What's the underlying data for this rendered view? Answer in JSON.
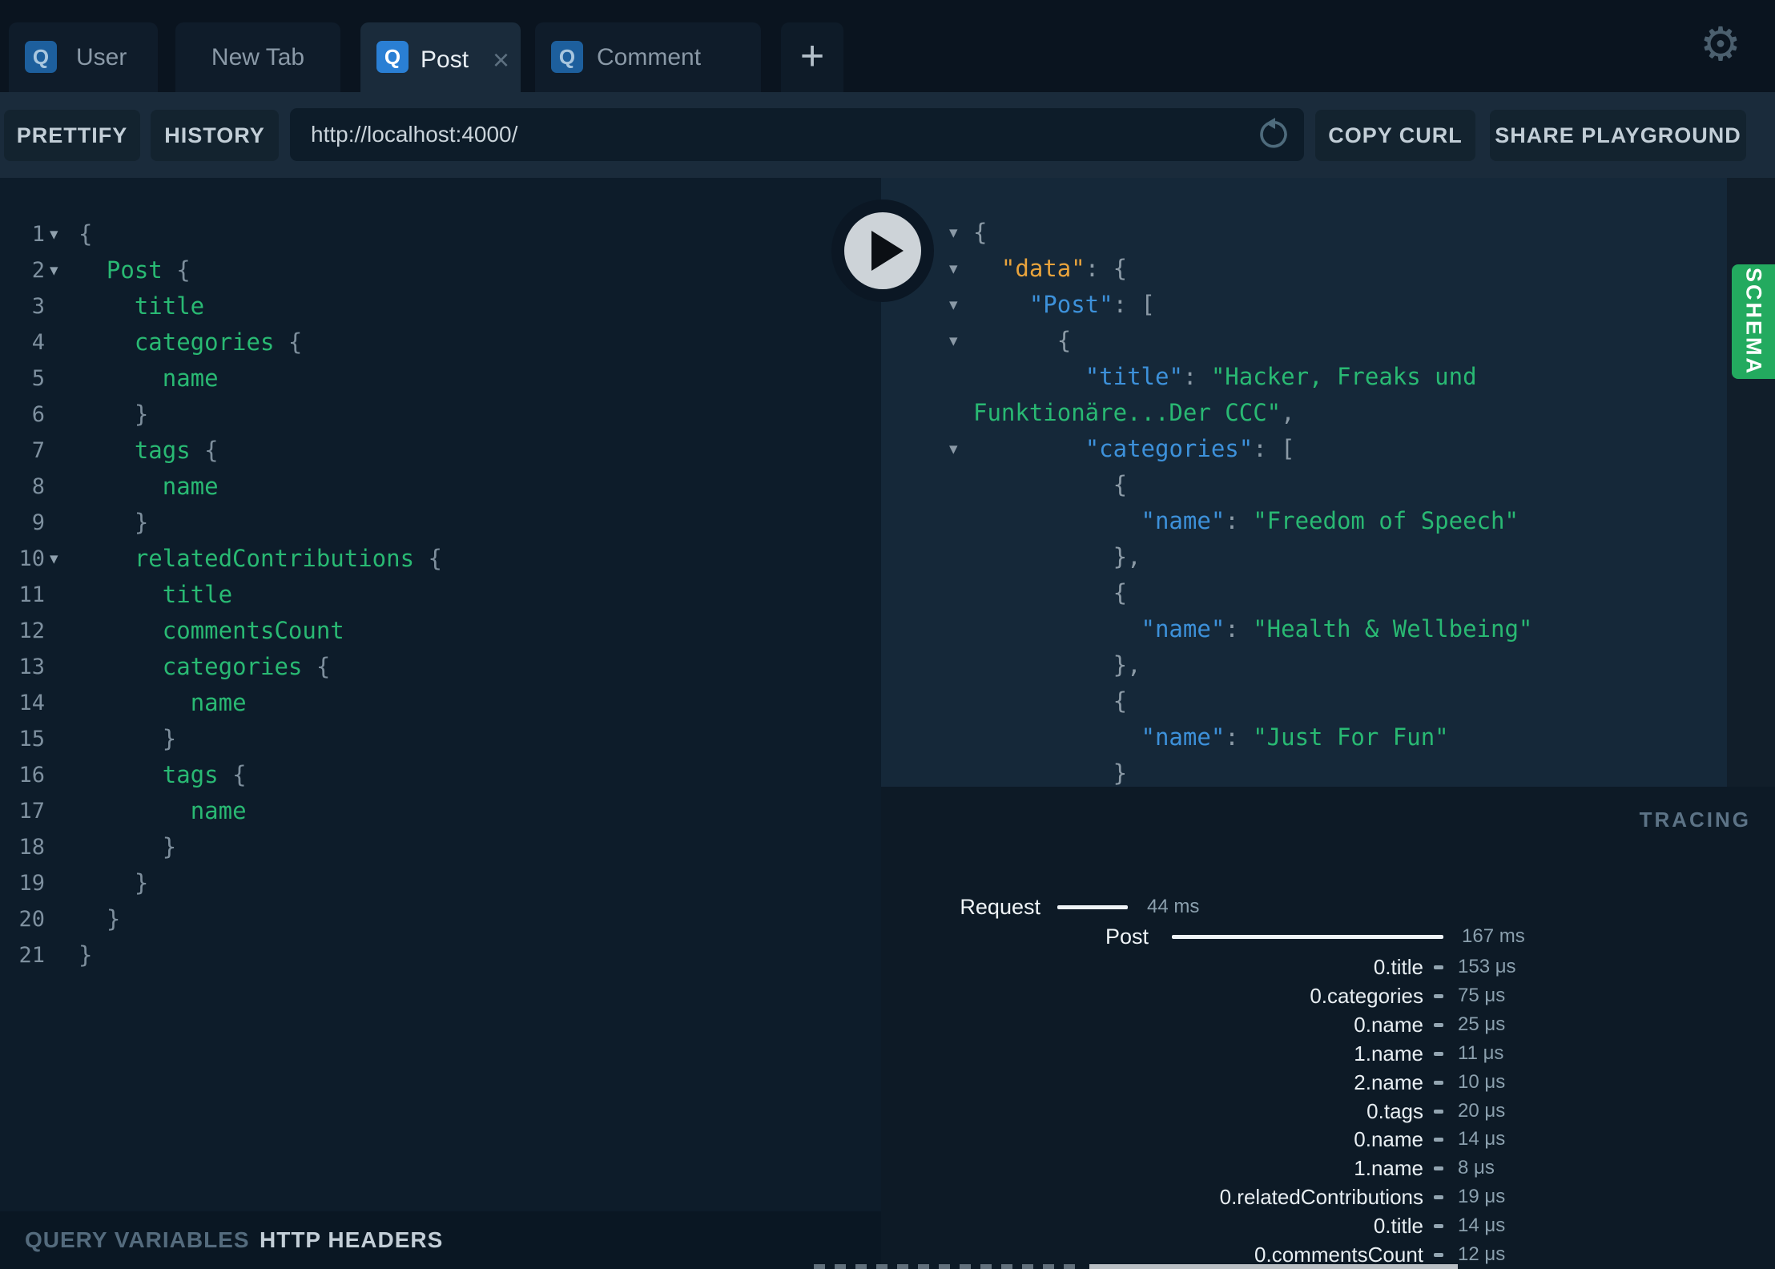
{
  "icons": {
    "gear": "⚙",
    "fold": "▾",
    "close": "×",
    "plus": "+",
    "badge_query": "Q"
  },
  "tabbar": {
    "tabs": [
      {
        "label": "User",
        "badge": "Q",
        "active": false,
        "closable": false
      },
      {
        "label": "New Tab",
        "badge": null,
        "active": false,
        "closable": false
      },
      {
        "label": "Post",
        "badge": "Q",
        "active": true,
        "closable": true
      },
      {
        "label": "Comment",
        "badge": "Q",
        "active": false,
        "closable": false
      }
    ]
  },
  "toolbar": {
    "prettify_label": "PRETTIFY",
    "history_label": "HISTORY",
    "url_value": "http://localhost:4000/",
    "copy_curl_label": "COPY CURL",
    "share_label": "SHARE PLAYGROUND"
  },
  "query_editor": {
    "lines": [
      {
        "n": 1,
        "ind": 0,
        "field": "",
        "brace": "{",
        "fold": true
      },
      {
        "n": 2,
        "ind": 2,
        "field": "Post",
        "brace": " {",
        "fold": true
      },
      {
        "n": 3,
        "ind": 4,
        "field": "title",
        "brace": "",
        "fold": false
      },
      {
        "n": 4,
        "ind": 4,
        "field": "categories",
        "brace": " {",
        "fold": false
      },
      {
        "n": 5,
        "ind": 6,
        "field": "name",
        "brace": "",
        "fold": false
      },
      {
        "n": 6,
        "ind": 4,
        "field": "",
        "brace": "}",
        "fold": false
      },
      {
        "n": 7,
        "ind": 4,
        "field": "tags",
        "brace": " {",
        "fold": false
      },
      {
        "n": 8,
        "ind": 6,
        "field": "name",
        "brace": "",
        "fold": false
      },
      {
        "n": 9,
        "ind": 4,
        "field": "",
        "brace": "}",
        "fold": false
      },
      {
        "n": 10,
        "ind": 4,
        "field": "relatedContributions",
        "brace": " {",
        "fold": true
      },
      {
        "n": 11,
        "ind": 6,
        "field": "title",
        "brace": "",
        "fold": false
      },
      {
        "n": 12,
        "ind": 6,
        "field": "commentsCount",
        "brace": "",
        "fold": false
      },
      {
        "n": 13,
        "ind": 6,
        "field": "categories",
        "brace": " {",
        "fold": false
      },
      {
        "n": 14,
        "ind": 8,
        "field": "name",
        "brace": "",
        "fold": false
      },
      {
        "n": 15,
        "ind": 6,
        "field": "",
        "brace": "}",
        "fold": false
      },
      {
        "n": 16,
        "ind": 6,
        "field": "tags",
        "brace": " {",
        "fold": false
      },
      {
        "n": 17,
        "ind": 8,
        "field": "name",
        "brace": "",
        "fold": false
      },
      {
        "n": 18,
        "ind": 6,
        "field": "",
        "brace": "}",
        "fold": false
      },
      {
        "n": 19,
        "ind": 4,
        "field": "",
        "brace": "}",
        "fold": false
      },
      {
        "n": 20,
        "ind": 2,
        "field": "",
        "brace": "}",
        "fold": false
      },
      {
        "n": 21,
        "ind": 0,
        "field": "",
        "brace": "}",
        "fold": false
      }
    ]
  },
  "response": {
    "lines": [
      {
        "ind": 0,
        "fold": true,
        "segs": [
          [
            "{",
            "punc"
          ]
        ]
      },
      {
        "ind": 2,
        "fold": true,
        "segs": [
          [
            "\"data\"",
            "datakey"
          ],
          [
            ": ",
            "punc"
          ],
          [
            "{",
            "punc"
          ]
        ]
      },
      {
        "ind": 4,
        "fold": true,
        "segs": [
          [
            "\"Post\"",
            "key"
          ],
          [
            ": ",
            "punc"
          ],
          [
            "[",
            "punc"
          ]
        ]
      },
      {
        "ind": 6,
        "fold": true,
        "segs": [
          [
            "{",
            "punc"
          ]
        ]
      },
      {
        "ind": 8,
        "fold": false,
        "segs": [
          [
            "\"title\"",
            "key"
          ],
          [
            ": ",
            "punc"
          ],
          [
            "\"Hacker, Freaks und",
            "str"
          ]
        ]
      },
      {
        "ind": 0,
        "fold": false,
        "segs": [
          [
            "Funktionäre...Der CCC\"",
            "str"
          ],
          [
            ",",
            "punc"
          ]
        ]
      },
      {
        "ind": 8,
        "fold": true,
        "segs": [
          [
            "\"categories\"",
            "key"
          ],
          [
            ": ",
            "punc"
          ],
          [
            "[",
            "punc"
          ]
        ]
      },
      {
        "ind": 10,
        "fold": false,
        "segs": [
          [
            "{",
            "punc"
          ]
        ]
      },
      {
        "ind": 12,
        "fold": false,
        "segs": [
          [
            "\"name\"",
            "key"
          ],
          [
            ": ",
            "punc"
          ],
          [
            "\"Freedom of Speech\"",
            "str"
          ]
        ]
      },
      {
        "ind": 10,
        "fold": false,
        "segs": [
          [
            "},",
            "punc"
          ]
        ]
      },
      {
        "ind": 10,
        "fold": false,
        "segs": [
          [
            "{",
            "punc"
          ]
        ]
      },
      {
        "ind": 12,
        "fold": false,
        "segs": [
          [
            "\"name\"",
            "key"
          ],
          [
            ": ",
            "punc"
          ],
          [
            "\"Health & Wellbeing\"",
            "str"
          ]
        ]
      },
      {
        "ind": 10,
        "fold": false,
        "segs": [
          [
            "},",
            "punc"
          ]
        ]
      },
      {
        "ind": 10,
        "fold": false,
        "segs": [
          [
            "{",
            "punc"
          ]
        ]
      },
      {
        "ind": 12,
        "fold": false,
        "segs": [
          [
            "\"name\"",
            "key"
          ],
          [
            ": ",
            "punc"
          ],
          [
            "\"Just For Fun\"",
            "str"
          ]
        ]
      },
      {
        "ind": 10,
        "fold": false,
        "segs": [
          [
            "}",
            "punc"
          ]
        ]
      },
      {
        "ind": 8,
        "fold": false,
        "segs": [
          [
            "]",
            "punc"
          ]
        ]
      }
    ]
  },
  "schema_tab": {
    "label": "SCHEMA"
  },
  "tracing": {
    "title": "TRACING",
    "request_row": {
      "label": "Request",
      "duration": "44 ms"
    },
    "resolver_row": {
      "label": "Post",
      "duration": "167 ms"
    },
    "field_rows": [
      {
        "label": "0.title",
        "duration": "153 μs"
      },
      {
        "label": "0.categories",
        "duration": "75 μs"
      },
      {
        "label": "0.name",
        "duration": "25 μs"
      },
      {
        "label": "1.name",
        "duration": "11 μs"
      },
      {
        "label": "2.name",
        "duration": "10 μs"
      },
      {
        "label": "0.tags",
        "duration": "20 μs"
      },
      {
        "label": "0.name",
        "duration": "14 μs"
      },
      {
        "label": "1.name",
        "duration": "8 μs"
      },
      {
        "label": "0.relatedContributions",
        "duration": "19 μs"
      },
      {
        "label": "0.title",
        "duration": "14 μs"
      },
      {
        "label": "0.commentsCount",
        "duration": "12 μs"
      }
    ]
  },
  "bottom_bar": {
    "query_variables_label": "QUERY VARIABLES",
    "http_headers_label": "HTTP HEADERS"
  }
}
